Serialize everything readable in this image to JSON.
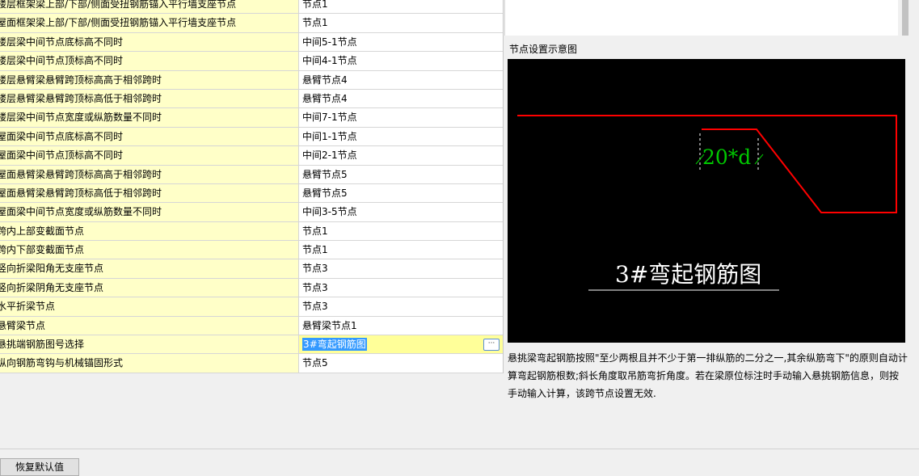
{
  "rows": [
    {
      "name": "楼层框架梁上部/下部/侧面受扭钢筋锚入平行墙支座节点",
      "value": "节点1"
    },
    {
      "name": "屋面框架梁上部/下部/侧面受扭钢筋锚入平行墙支座节点",
      "value": "节点1"
    },
    {
      "name": "楼层梁中间节点底标高不同时",
      "value": "中间5-1节点"
    },
    {
      "name": "楼层梁中间节点顶标高不同时",
      "value": "中间4-1节点"
    },
    {
      "name": "楼层悬臂梁悬臂跨顶标高高于相邻跨时",
      "value": "悬臂节点4"
    },
    {
      "name": "楼层悬臂梁悬臂跨顶标高低于相邻跨时",
      "value": "悬臂节点4"
    },
    {
      "name": "楼层梁中间节点宽度或纵筋数量不同时",
      "value": "中间7-1节点"
    },
    {
      "name": "屋面梁中间节点底标高不同时",
      "value": "中间1-1节点"
    },
    {
      "name": "屋面梁中间节点顶标高不同时",
      "value": "中间2-1节点"
    },
    {
      "name": "屋面悬臂梁悬臂跨顶标高高于相邻跨时",
      "value": "悬臂节点5"
    },
    {
      "name": "屋面悬臂梁悬臂跨顶标高低于相邻跨时",
      "value": "悬臂节点5"
    },
    {
      "name": "屋面梁中间节点宽度或纵筋数量不同时",
      "value": "中间3-5节点"
    },
    {
      "name": "跨内上部变截面节点",
      "value": "节点1"
    },
    {
      "name": "跨内下部变截面节点",
      "value": "节点1"
    },
    {
      "name": "竖向折梁阳角无支座节点",
      "value": "节点3"
    },
    {
      "name": "竖向折梁阴角无支座节点",
      "value": "节点3"
    },
    {
      "name": "水平折梁节点",
      "value": "节点3"
    },
    {
      "name": "悬臂梁节点",
      "value": "悬臂梁节点1"
    },
    {
      "name": "悬挑端钢筋图号选择",
      "value": "3#弯起钢筋图",
      "selected": true
    },
    {
      "name": "纵向钢筋弯钩与机械锚固形式",
      "value": "节点5"
    }
  ],
  "preview": {
    "title": "节点设置示意图",
    "diagram_dimension_label": "20*d",
    "diagram_caption": "3#弯起钢筋图",
    "description": "悬挑梁弯起钢筋按照\"至少两根且并不少于第一排纵筋的二分之一,其余纵筋弯下\"的原则自动计算弯起钢筋根数;斜长角度取吊筋弯折角度。若在梁原位标注时手动输入悬挑钢筋信息，则按手动输入计算，该跨节点设置无效."
  },
  "ellipsis_label": "···",
  "restore_button": "恢复默认值",
  "colors": {
    "name_bg": "#ffffc8",
    "selected_bg": "#ffff99",
    "highlight": "#3399ff",
    "rebar": "#ff0000",
    "dimension": "#00c800"
  }
}
